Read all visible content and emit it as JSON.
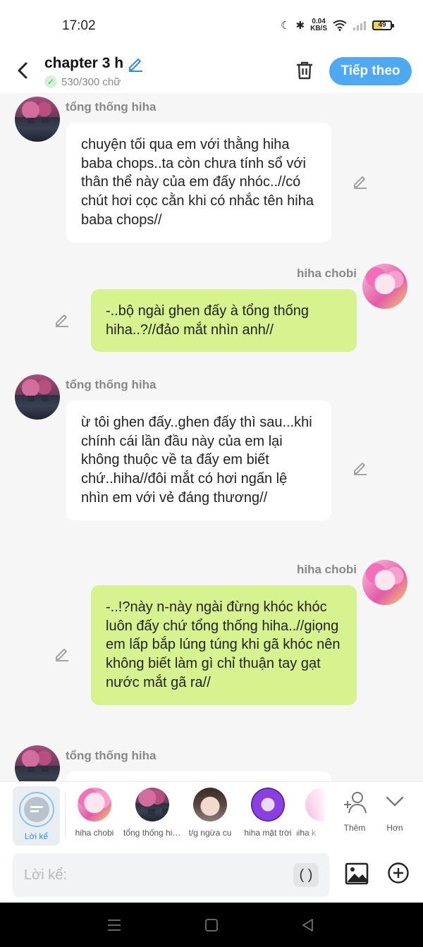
{
  "status_bar": {
    "time": "17:02",
    "net_speed_value": "0.04",
    "net_speed_unit": "KB/S",
    "battery": "49"
  },
  "header": {
    "title": "chapter 3 h",
    "word_count": "530/300 chữ",
    "next_label": "Tiếp theo",
    "accent_color": "#4ea8f2"
  },
  "messages": [
    {
      "sender": "tổng thống hiha",
      "side": "left",
      "text": "chuyện tối qua em với thằng hiha baba chops..ta còn chưa tính sổ với thân thể này của em đấy nhóc..//có chút hơi cọc cằn khi có nhắc tên hiha baba chops//"
    },
    {
      "sender": "hiha chobi",
      "side": "right",
      "text": "-..bộ ngài ghen đấy à tổng thống hiha..?//đảo mắt nhìn anh//"
    },
    {
      "sender": "tổng thống hiha",
      "side": "left",
      "text": "ừ tôi ghen đấy..ghen đấy thì sau...khi chính cái lần đầu này của em lại không thuộc về ta đấy em biết chứ..hiha//đôi mắt có hơi ngấn lệ nhìn em với vẻ đáng thương//"
    },
    {
      "sender": "hiha chobi",
      "side": "right",
      "text": "-..!?này n-này ngài đừng khóc khóc luôn đấy chứ tổng thống hiha..//giọng em lấp bắp lúng túng khi gã khóc nên không biết làm gì chỉ thuận tay gạt nước mắt gã ra//"
    },
    {
      "sender": "tổng thống hiha",
      "side": "left",
      "text": ""
    }
  ],
  "character_bar": {
    "narrator_label": "Lời kể",
    "characters": [
      {
        "label": "hiha chobi",
        "avatar": "pink"
      },
      {
        "label": "tổng thống hiha",
        "avatar": "dark"
      },
      {
        "label": "t/g ngừa cu",
        "avatar": "girl"
      },
      {
        "label": "hiha mặt trời",
        "avatar": "purple"
      },
      {
        "label": "hiha k",
        "avatar": "pink2"
      }
    ],
    "add_label": "Thêm",
    "more_label": "Hơn"
  },
  "input_bar": {
    "placeholder": "Lời kể:",
    "paren_label": "( )"
  }
}
